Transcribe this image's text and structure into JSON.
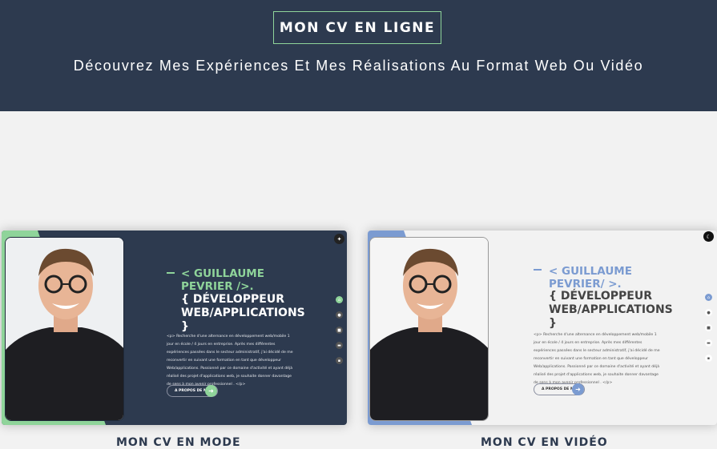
{
  "hero": {
    "title": "MON CV EN LIGNE",
    "subtitle": "Découvrez Mes Expériences Et Mes Réalisations Au Format Web Ou Vidéo"
  },
  "cv_dark": {
    "name": "< GUILLAUME PEVRIER />.",
    "role": "{ DÉVELOPPEUR WEB/APPLICATIONS }",
    "bio": "<p> Recherche d'une alternance en développement web/mobile 1 jour en école / 4 jours en entreprise. Après mes différentes expériences passées dans le secteur administratif, j'ai décidé de me reconvertir en suivant une formation en tant que développeur Web/applications. Passionné par ce domaine d'activité et ayant déjà réalisé des projet d'applications web, je souhaite donner davantage de sens à mon avenir professionnel . </p>",
    "about_label": "A PROPOS DE MOI",
    "accent": "#8fd49a",
    "theme_icon": "lightbulb-icon"
  },
  "cv_light": {
    "name": "< GUILLAUME PEVRIER/ >.",
    "role": "{ DÉVELOPPEUR WEB/APPLICATIONS }",
    "bio": "<p> Recherche d'une alternance en développement web/mobile 1 jour en école / 4 jours en entreprise. Après mes différentes expériences passées dans le secteur administratif, j'ai décidé de me reconvertir en suivant une formation en tant que développeur Web/applications. Passionné par ce domaine d'activité et ayant déjà réalisé des projet d'applications web, je souhaite donner davantage de sens à mon avenir professionnel . </p>",
    "about_label": "A PROPOS DE MOI",
    "accent": "#7b9bd1",
    "theme_icon": "moon-icon"
  },
  "nav_icons": [
    "home-icon",
    "user-icon",
    "briefcase-icon",
    "folder-icon",
    "chat-icon"
  ],
  "captions": {
    "left": "MON CV EN MODE",
    "right": "MON CV EN VIDÉO"
  }
}
